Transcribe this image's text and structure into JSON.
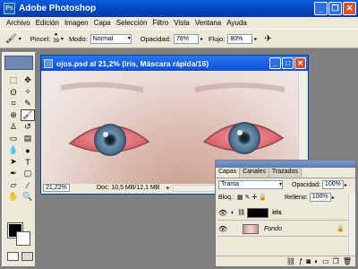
{
  "app": {
    "title": "Adobe Photoshop",
    "logo_text": "Ps"
  },
  "menu": [
    "Archivo",
    "Edición",
    "Imagen",
    "Capa",
    "Selección",
    "Filtro",
    "Vista",
    "Ventana",
    "Ayuda"
  ],
  "options": {
    "pincel_label": "Pincel:",
    "brush_size": "39",
    "modo_label": "Modo:",
    "modo_value": "Normal",
    "opacidad_label": "Opacidad:",
    "opacidad_value": "78%",
    "flujo_label": "Flujo:",
    "flujo_value": "80%"
  },
  "document": {
    "title": "ojos.psd al 21,2% (iris, Máscara rápida/16)",
    "zoom": "21,22%",
    "doc_info": "Doc: 10,5 MB/12,1 MB"
  },
  "layers_panel": {
    "tabs": [
      "Capas",
      "Canales",
      "Trazados"
    ],
    "blend_mode": "Trama",
    "opacity_label": "Opacidad:",
    "opacity_value": "100%",
    "lock_label": "Bloq.:",
    "fill_label": "Relleno:",
    "fill_value": "100%",
    "layers": [
      {
        "name": "iris",
        "italic": false
      },
      {
        "name": "Fondo",
        "italic": true
      }
    ]
  }
}
